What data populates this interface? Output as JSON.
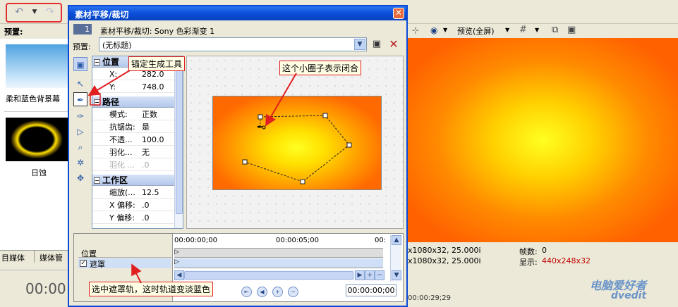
{
  "background_app": {
    "preset_label": "预置:",
    "thumbnails": [
      {
        "label": "柔和蓝色背景幕"
      },
      {
        "label": "日蚀"
      }
    ],
    "media_tabs": [
      "目媒体",
      "媒体管"
    ],
    "timecode": "00:00:",
    "preview_toolbar": {
      "preview_quality": "预览(全屏)"
    },
    "info": {
      "line1": "x1080x32, 25.000i",
      "line2": "x1080x32, 25.000i",
      "frames_label": "帧数:",
      "frames_value": "0",
      "display_label": "显示:",
      "display_value": "440x248x32"
    },
    "bottom_time": "00:00:29;29",
    "watermark": "电脑爱好者",
    "watermark2": "dvedit"
  },
  "dialog": {
    "title": "素材平移/裁切",
    "track_number": "1",
    "track_title": "素材平移/裁切: Sony 色彩渐变 1",
    "preset_label": "预置:",
    "preset_value": "(无标题)",
    "sections": [
      {
        "title": "位置",
        "rows": [
          {
            "key": "X:",
            "value": "282.0"
          },
          {
            "key": "Y:",
            "value": "748.0"
          }
        ]
      },
      {
        "title": "路径",
        "rows": [
          {
            "key": "模式:",
            "value": "正数"
          },
          {
            "key": "抗锯齿:",
            "value": "是"
          },
          {
            "key": "不透...",
            "value": "100.0"
          },
          {
            "key": "羽化...",
            "value": "无"
          },
          {
            "key": "羽化 ...",
            "value": ".0"
          }
        ]
      },
      {
        "title": "工作区",
        "rows": [
          {
            "key": "缩放(...",
            "value": "12.5"
          },
          {
            "key": "X 偏移:",
            "value": ".0"
          },
          {
            "key": "Y 偏移:",
            "value": ".0"
          }
        ]
      }
    ],
    "timeline": {
      "tracks": [
        "位置",
        "遮罩"
      ],
      "mask_checked": "✓",
      "ruler": [
        "00:00:00;00",
        "00:00:05;00",
        "00:"
      ],
      "timecode": "00:00:00;00"
    }
  },
  "callouts": {
    "anchor_tool": "锚定生成工具",
    "closed_loop": "这个小圈子表示闭合",
    "mask_track": "选中遮罩轨，这时轨道变淡蓝色"
  },
  "colors": {
    "callout_border": "#e02020",
    "title_bar": "#0a4ed8",
    "mask_track_highlight": "#cfe0f6"
  }
}
